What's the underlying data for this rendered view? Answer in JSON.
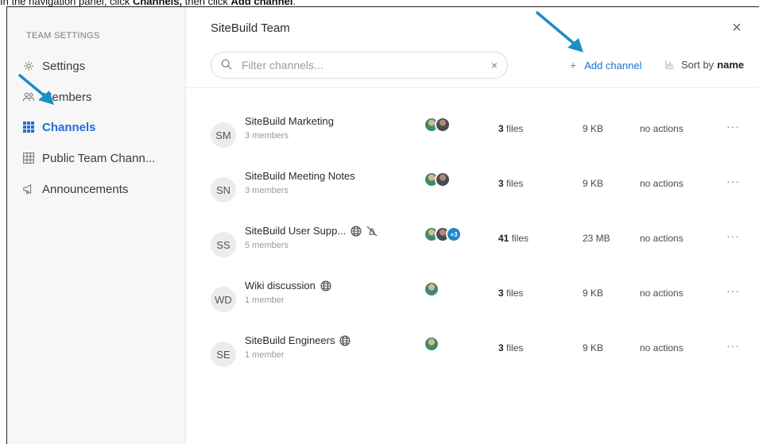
{
  "instruction": {
    "prefix": "In the navigation panel, click ",
    "bold1": "Channels,",
    "middle": " then click ",
    "bold2": "Add channel",
    "suffix": "."
  },
  "sidebar": {
    "title": "TEAM SETTINGS",
    "items": [
      {
        "label": "Settings",
        "icon": "gear-icon"
      },
      {
        "label": "Members",
        "icon": "members-icon"
      },
      {
        "label": "Channels",
        "icon": "grid-icon",
        "active": true
      },
      {
        "label": "Public Team Chann...",
        "icon": "table-icon"
      },
      {
        "label": "Announcements",
        "icon": "megaphone-icon"
      }
    ]
  },
  "header": {
    "title": "SiteBuild Team",
    "close": "×"
  },
  "search": {
    "placeholder": "Filter channels...",
    "clear": "×"
  },
  "toolbar": {
    "add_channel": "Add channel",
    "sort_prefix": "Sort by",
    "sort_value": "name"
  },
  "channels": [
    {
      "initials": "SM",
      "name": "SiteBuild Marketing",
      "members": "3 members",
      "files_count": "3",
      "files_label": " files",
      "size": "9 KB",
      "actions": "no actions",
      "globe": false,
      "muted": false,
      "more_count": ""
    },
    {
      "initials": "SN",
      "name": "SiteBuild Meeting Notes",
      "members": "3 members",
      "files_count": "3",
      "files_label": " files",
      "size": "9 KB",
      "actions": "no actions",
      "globe": false,
      "muted": false,
      "more_count": ""
    },
    {
      "initials": "SS",
      "name": "SiteBuild User Supp...",
      "members": "5 members",
      "files_count": "41",
      "files_label": " files",
      "size": "23 MB",
      "actions": "no actions",
      "globe": true,
      "muted": true,
      "more_count": "+3"
    },
    {
      "initials": "WD",
      "name": "Wiki discussion",
      "members": "1 member",
      "files_count": "3",
      "files_label": " files",
      "size": "9 KB",
      "actions": "no actions",
      "globe": true,
      "muted": false,
      "more_count": ""
    },
    {
      "initials": "SE",
      "name": "SiteBuild Engineers",
      "members": "1 member",
      "files_count": "3",
      "files_label": " files",
      "size": "9 KB",
      "actions": "no actions",
      "globe": true,
      "muted": false,
      "more_count": ""
    }
  ],
  "more_label": "···",
  "colors": {
    "accent": "#1d6fd8",
    "arrow": "#1a8fc4"
  }
}
